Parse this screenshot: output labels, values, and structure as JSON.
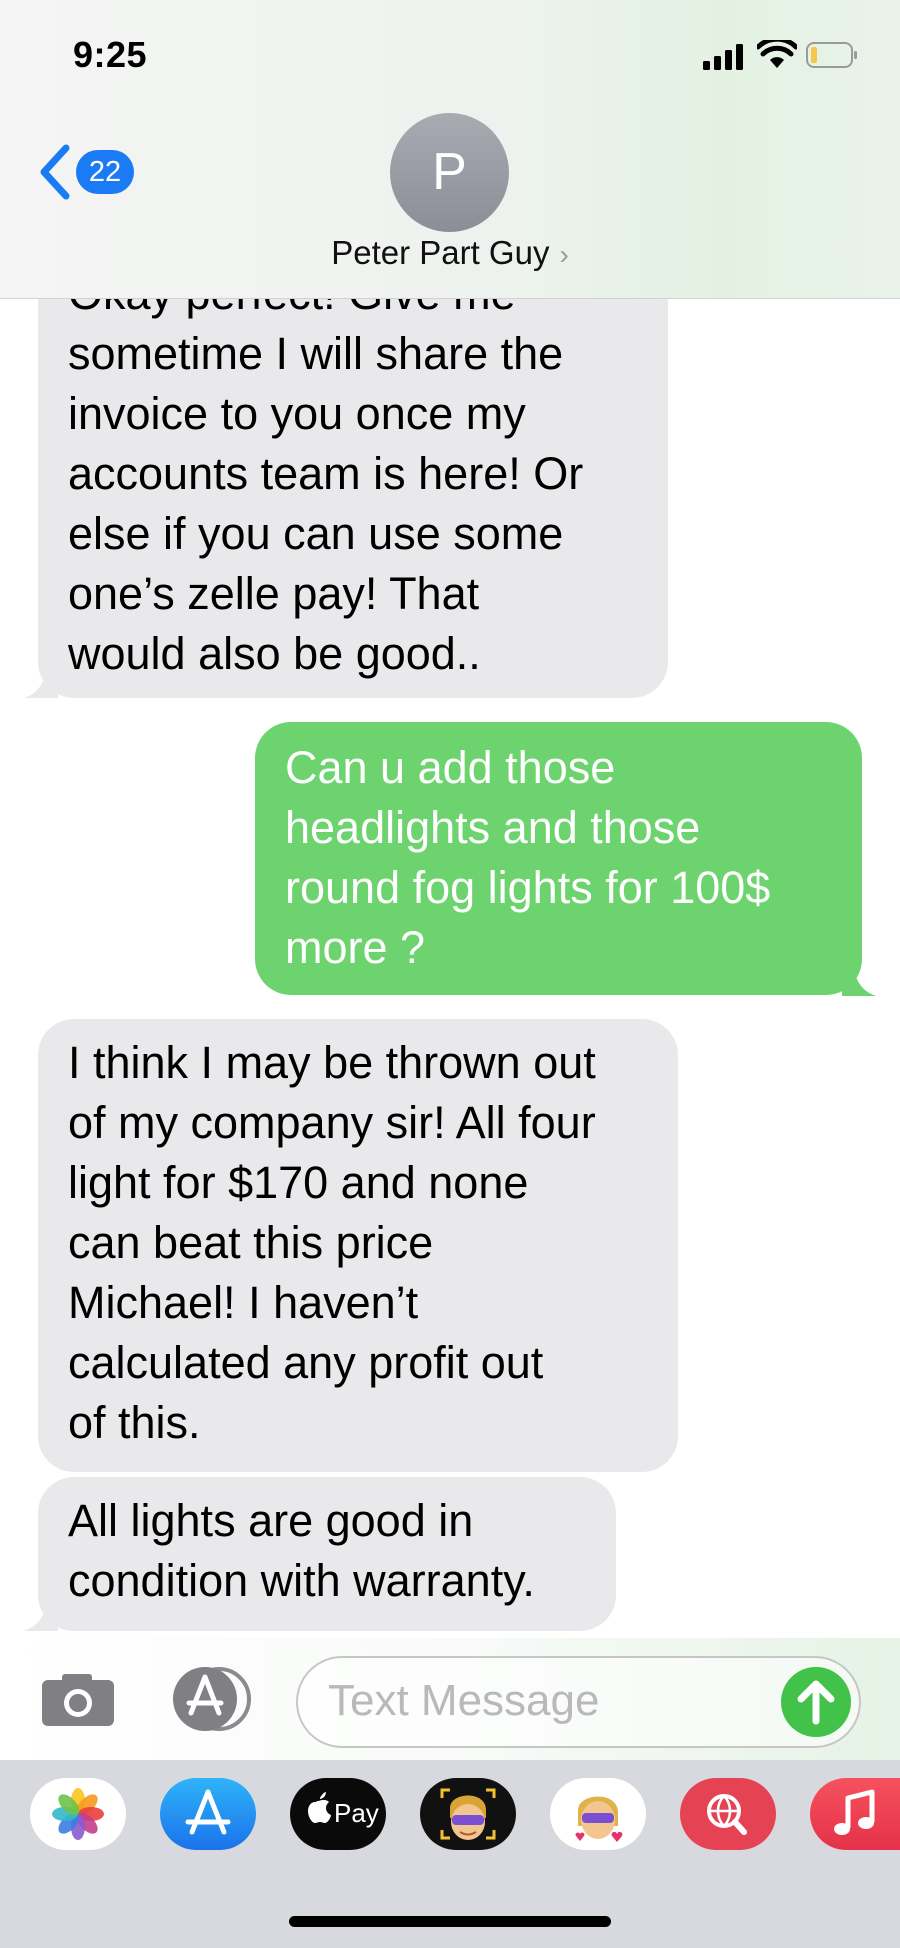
{
  "status_bar": {
    "time": "9:25"
  },
  "nav": {
    "back_count": "22",
    "avatar_initial": "P",
    "contact_name": "Peter Part Guy",
    "chevron": "›"
  },
  "messages": [
    {
      "direction": "incoming",
      "lines": [
        "Okay perfect! Give me",
        "sometime I will share the",
        "invoice to you once my",
        "accounts team is here! Or",
        "else if you can use some",
        "one’s zelle pay! That",
        "would also be good.."
      ]
    },
    {
      "direction": "outgoing",
      "lines": [
        "Can u add those",
        "headlights and those",
        "round fog lights for 100$",
        "more ?"
      ]
    },
    {
      "direction": "incoming",
      "lines": [
        "I think I may be thrown out",
        "of my company sir! All four",
        "light for $170 and none",
        "can beat this price",
        "Michael! I haven’t",
        "calculated any profit out",
        "of this."
      ]
    },
    {
      "direction": "incoming",
      "lines": [
        "All lights are good in",
        "condition with warranty."
      ]
    }
  ],
  "input": {
    "placeholder": "Text Message"
  },
  "app_drawer": {
    "items": [
      {
        "name": "Photos",
        "icon": "photos-icon"
      },
      {
        "name": "App Store",
        "icon": "app-store-icon"
      },
      {
        "name": "Apple Pay",
        "icon": "apple-pay-icon",
        "label": "Pay"
      },
      {
        "name": "Memoji",
        "icon": "memoji-icon"
      },
      {
        "name": "Memoji Stickers",
        "icon": "memoji-stickers-icon"
      },
      {
        "name": "Images",
        "icon": "globe-search-icon"
      },
      {
        "name": "Music",
        "icon": "music-icon"
      }
    ]
  },
  "colors": {
    "incoming_bubble": "#e9e9eb",
    "outgoing_bubble": "#6dd36e",
    "badge": "#1b7bf5",
    "send_button": "#43c24a"
  }
}
